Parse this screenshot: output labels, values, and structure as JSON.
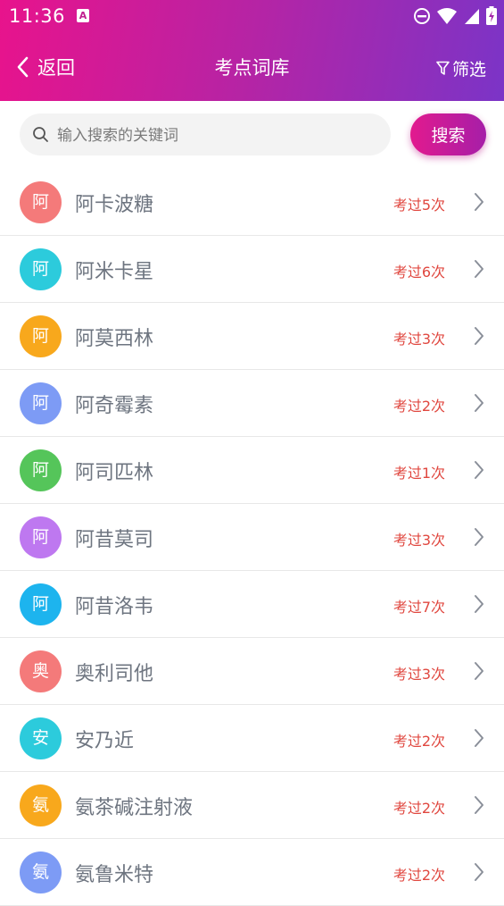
{
  "status_bar": {
    "time": "11:36",
    "notification_badge": "A"
  },
  "nav": {
    "back_label": "返回",
    "title": "考点词库",
    "filter_label": "筛选"
  },
  "search": {
    "placeholder": "输入搜索的关键词",
    "value": "",
    "button_label": "搜索"
  },
  "colors": {
    "gradient_start": "#e8138c",
    "gradient_end": "#7b34c7",
    "count_text": "#e0473f",
    "term_text": "#6e7580"
  },
  "items": [
    {
      "avatar": "阿",
      "term": "阿卡波糖",
      "count": "考过5次",
      "color": "#f47a7a"
    },
    {
      "avatar": "阿",
      "term": "阿米卡星",
      "count": "考过6次",
      "color": "#2ccbdc"
    },
    {
      "avatar": "阿",
      "term": "阿莫西林",
      "count": "考过3次",
      "color": "#f8a81c"
    },
    {
      "avatar": "阿",
      "term": "阿奇霉素",
      "count": "考过2次",
      "color": "#7d9bf5"
    },
    {
      "avatar": "阿",
      "term": "阿司匹林",
      "count": "考过1次",
      "color": "#55c55a"
    },
    {
      "avatar": "阿",
      "term": "阿昔莫司",
      "count": "考过3次",
      "color": "#be78f0"
    },
    {
      "avatar": "阿",
      "term": "阿昔洛韦",
      "count": "考过7次",
      "color": "#1db4ee"
    },
    {
      "avatar": "奥",
      "term": "奥利司他",
      "count": "考过3次",
      "color": "#f47a7a"
    },
    {
      "avatar": "安",
      "term": "安乃近",
      "count": "考过2次",
      "color": "#2ccbdc"
    },
    {
      "avatar": "氨",
      "term": "氨茶碱注射液",
      "count": "考过2次",
      "color": "#f8a81c"
    },
    {
      "avatar": "氨",
      "term": "氨鲁米特",
      "count": "考过2次",
      "color": "#7d9bf5"
    }
  ]
}
